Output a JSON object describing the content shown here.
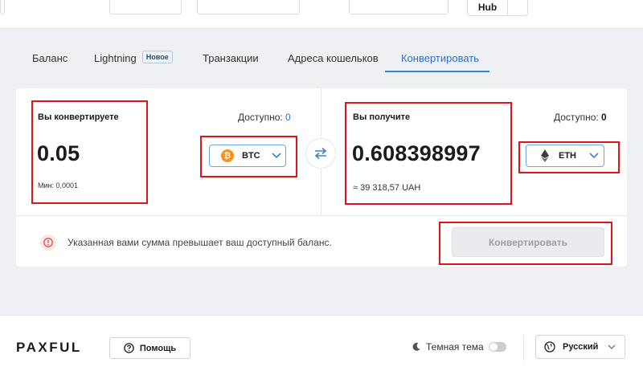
{
  "header": {
    "hub_label": "Hub"
  },
  "tabs": [
    {
      "label": "Баланс"
    },
    {
      "label": "Lightning",
      "badge": "Новое"
    },
    {
      "label": "Транзакции"
    },
    {
      "label": "Адреса кошельков"
    },
    {
      "label": "Конвертировать",
      "active": true
    }
  ],
  "from": {
    "label": "Вы конвертируете",
    "available_label": "Доступно:",
    "available_value": "0",
    "amount": "0.05",
    "min_text": "Мин: 0,0001",
    "currency": "BTC",
    "coin_icon": "bitcoin-icon",
    "coin_color": "#f7931a"
  },
  "to": {
    "label": "Вы получите",
    "available_label": "Доступно:",
    "available_value": "0",
    "amount": "0.608398997",
    "fiat_equivalent": "≈ 39 318,57 UAH",
    "currency": "ETH",
    "coin_icon": "ethereum-icon"
  },
  "warning": {
    "text": "Указанная вами сумма превышает ваш доступный баланс."
  },
  "convert_button": {
    "label": "Конвертировать"
  },
  "footer": {
    "logo": "PAXFUL",
    "help_label": "Помощь",
    "theme_label": "Темная тема",
    "language": "Русский"
  },
  "colors": {
    "accent": "#3b82d6",
    "highlight": "#e0141b",
    "warning": "#e74c4c"
  }
}
